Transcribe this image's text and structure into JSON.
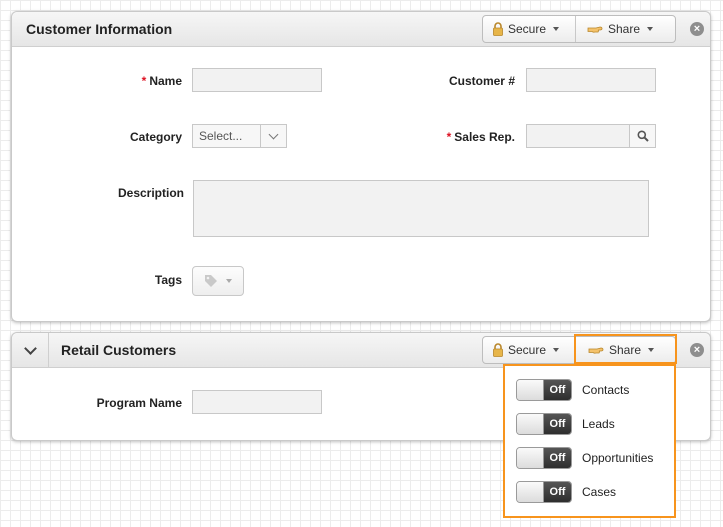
{
  "customer_panel": {
    "title": "Customer Information",
    "secure_label": "Secure",
    "share_label": "Share",
    "fields": {
      "name_label": "Name",
      "customer_no_label": "Customer #",
      "category_label": "Category",
      "category_value": "Select...",
      "sales_rep_label": "Sales Rep.",
      "description_label": "Description",
      "tags_label": "Tags"
    },
    "required_mark": "*"
  },
  "retail_panel": {
    "title": "Retail Customers",
    "secure_label": "Secure",
    "share_label": "Share",
    "program_name_label": "Program Name"
  },
  "share_menu": {
    "items": [
      {
        "label": "Contacts",
        "state": "Off"
      },
      {
        "label": "Leads",
        "state": "Off"
      },
      {
        "label": "Opportunities",
        "state": "Off"
      },
      {
        "label": "Cases",
        "state": "Off"
      }
    ]
  },
  "icons": {
    "close": "×",
    "accent_color": "#f7941d"
  }
}
